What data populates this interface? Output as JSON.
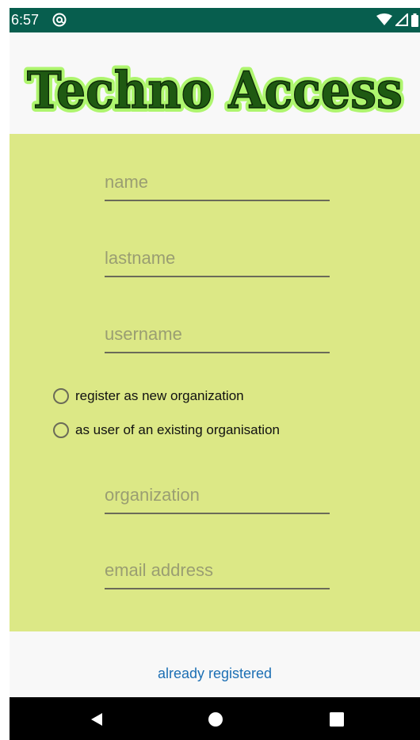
{
  "status_bar": {
    "time": "6:57",
    "app_icon": "at-sign-icon",
    "indicators": [
      "wifi-icon",
      "cellular-signal-icon",
      "battery-icon"
    ]
  },
  "header": {
    "logo_text": "Techno Access",
    "logo_fill_color": "#1f5a12",
    "logo_glow_color": "#aef56e"
  },
  "form": {
    "background_color": "#dce886",
    "name": {
      "value": "",
      "placeholder": "name"
    },
    "lastname": {
      "value": "",
      "placeholder": "lastname"
    },
    "username": {
      "value": "",
      "placeholder": "username"
    },
    "radio_new_org": {
      "label": "register as new organization",
      "checked": false
    },
    "radio_existing_org": {
      "label": "as user of an existing organisation",
      "checked": false
    },
    "organization": {
      "value": "",
      "placeholder": "organization"
    },
    "email": {
      "value": "",
      "placeholder": "email address"
    }
  },
  "footer": {
    "already_registered_label": "already registered",
    "link_color": "#1c6fb4"
  },
  "nav_bar": {
    "buttons": [
      "back-icon",
      "home-icon",
      "recents-icon"
    ]
  }
}
